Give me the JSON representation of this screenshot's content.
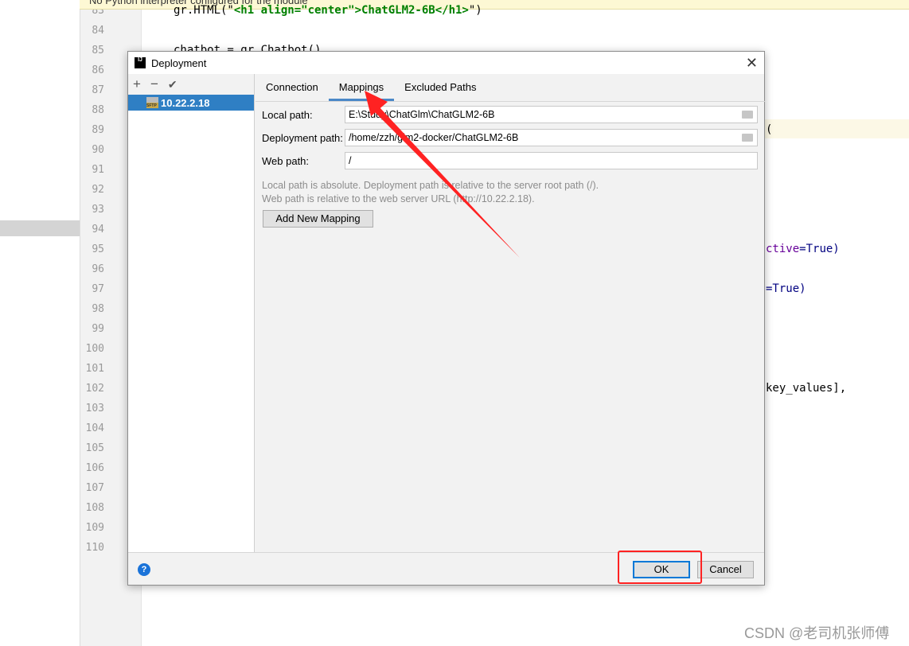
{
  "editor": {
    "banner": "No Python interpreter configured for the module",
    "line_numbers": [
      "83",
      "84",
      "85",
      "86",
      "87",
      "88",
      "89",
      "90",
      "91",
      "92",
      "93",
      "94",
      "95",
      "96",
      "97",
      "98",
      "99",
      "100",
      "101",
      "102",
      "103",
      "104",
      "105",
      "106",
      "107",
      "108",
      "109",
      "110"
    ],
    "code": {
      "l83a": "gr.HTML(\"",
      "l83b": "<h1 align=\"center\">ChatGLM2-6B</h1>",
      "l83c": "\")",
      "l85": "chatbot = gr.Chatbot()",
      "l89": "(",
      "l95a": "ctive",
      "l95b": "=True)",
      "l97a": "=True)",
      "l102": "key_values],"
    }
  },
  "dialog": {
    "title": "Deployment",
    "close_icon": "close-icon",
    "toolbar": {
      "add": "+",
      "remove": "−",
      "check": "✔"
    },
    "servers": [
      {
        "name": "10.22.2.18",
        "icon": "SFTP",
        "selected": true
      }
    ],
    "tabs": [
      {
        "label": "Connection"
      },
      {
        "label": "Mappings",
        "active": true
      },
      {
        "label": "Excluded Paths"
      }
    ],
    "fields": {
      "local_path": {
        "label": "Local path:",
        "value": "E:\\Study\\ChatGlm\\ChatGLM2-6B"
      },
      "deployment_path": {
        "label": "Deployment path:",
        "value": "/home/zzh/glm2-docker/ChatGLM2-6B"
      },
      "web_path": {
        "label": "Web path:",
        "value": "/"
      }
    },
    "hint1": "Local path is absolute. Deployment path is relative to the server root path (/).",
    "hint2": "Web path is relative to the web server URL (http://10.22.2.18).",
    "add_mapping": "Add New Mapping",
    "help": "?",
    "ok": "OK",
    "cancel": "Cancel"
  },
  "annotation_color": "#ff2222",
  "watermark": "CSDN @老司机张师傅"
}
